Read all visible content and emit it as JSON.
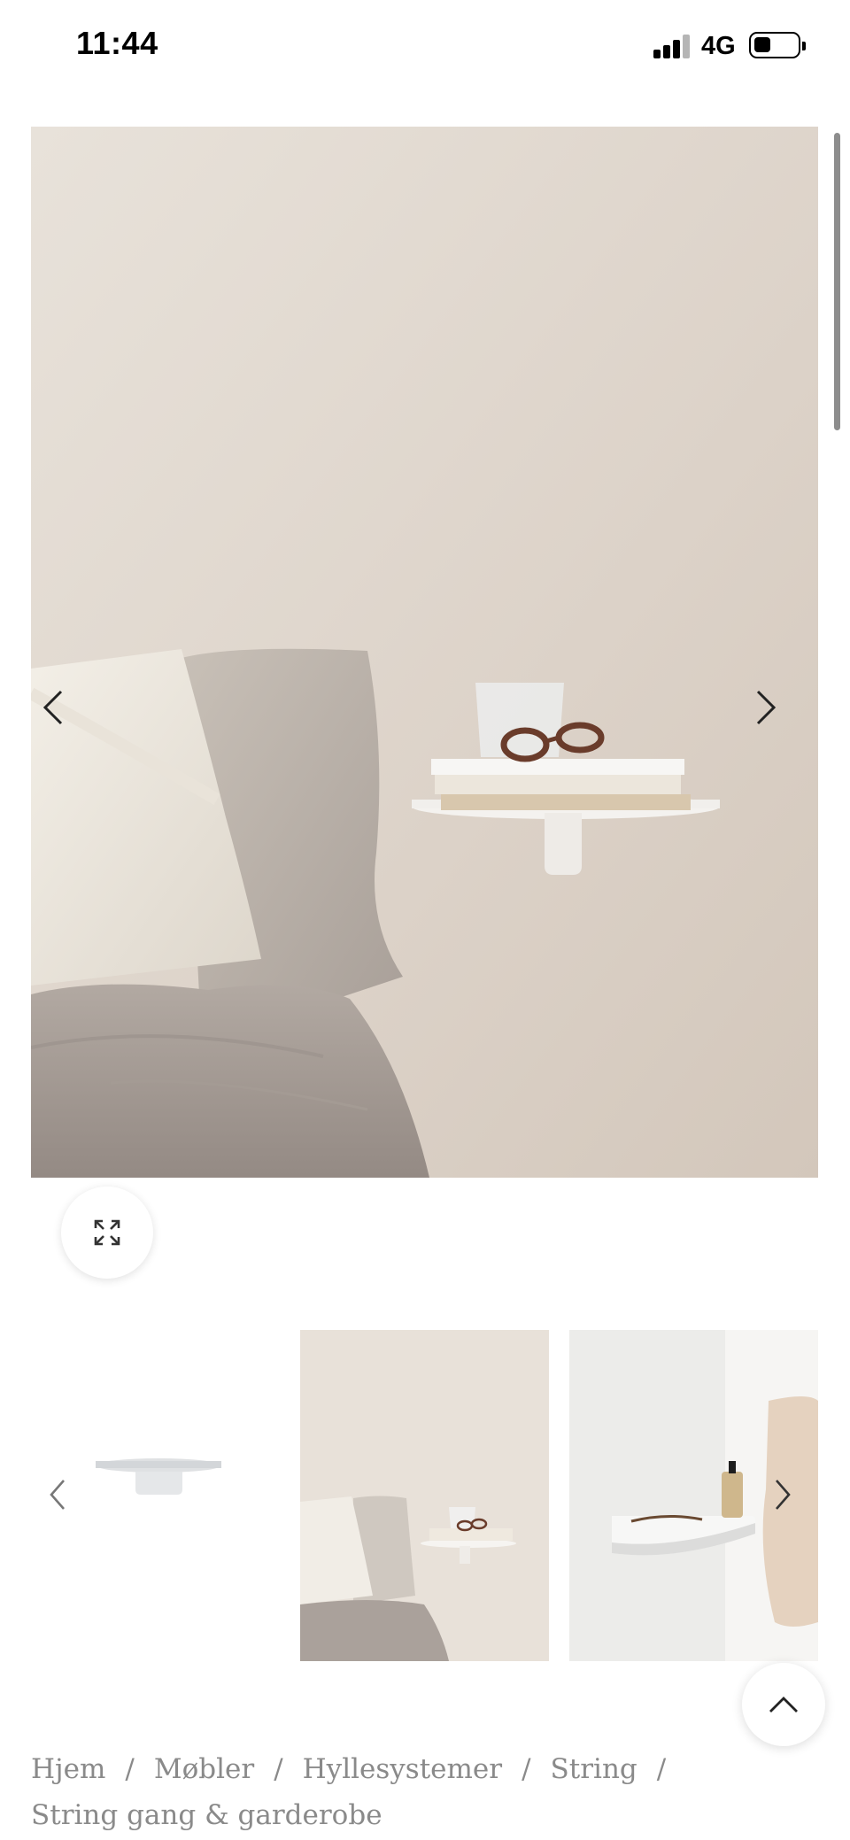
{
  "status_bar": {
    "time": "11:44",
    "network": "4G",
    "signal_icon": "signal-bars-icon",
    "battery_icon": "battery-icon"
  },
  "gallery": {
    "hero_image": "bedroom-wall-shelf-photo",
    "prev_icon": "chevron-left-icon",
    "next_icon": "chevron-right-icon",
    "expand_icon": "expand-arrows-icon",
    "thumbnails": [
      {
        "name": "shelf-product-thumbnail"
      },
      {
        "name": "bedroom-shelf-thumbnail"
      },
      {
        "name": "hallway-shelf-thumbnail"
      }
    ]
  },
  "back_to_top_icon": "chevron-up-icon",
  "breadcrumb": {
    "items": [
      "Hjem",
      "Møbler",
      "Hyllesystemer",
      "String"
    ],
    "separator": "/",
    "current": "String gang & garderobe"
  }
}
